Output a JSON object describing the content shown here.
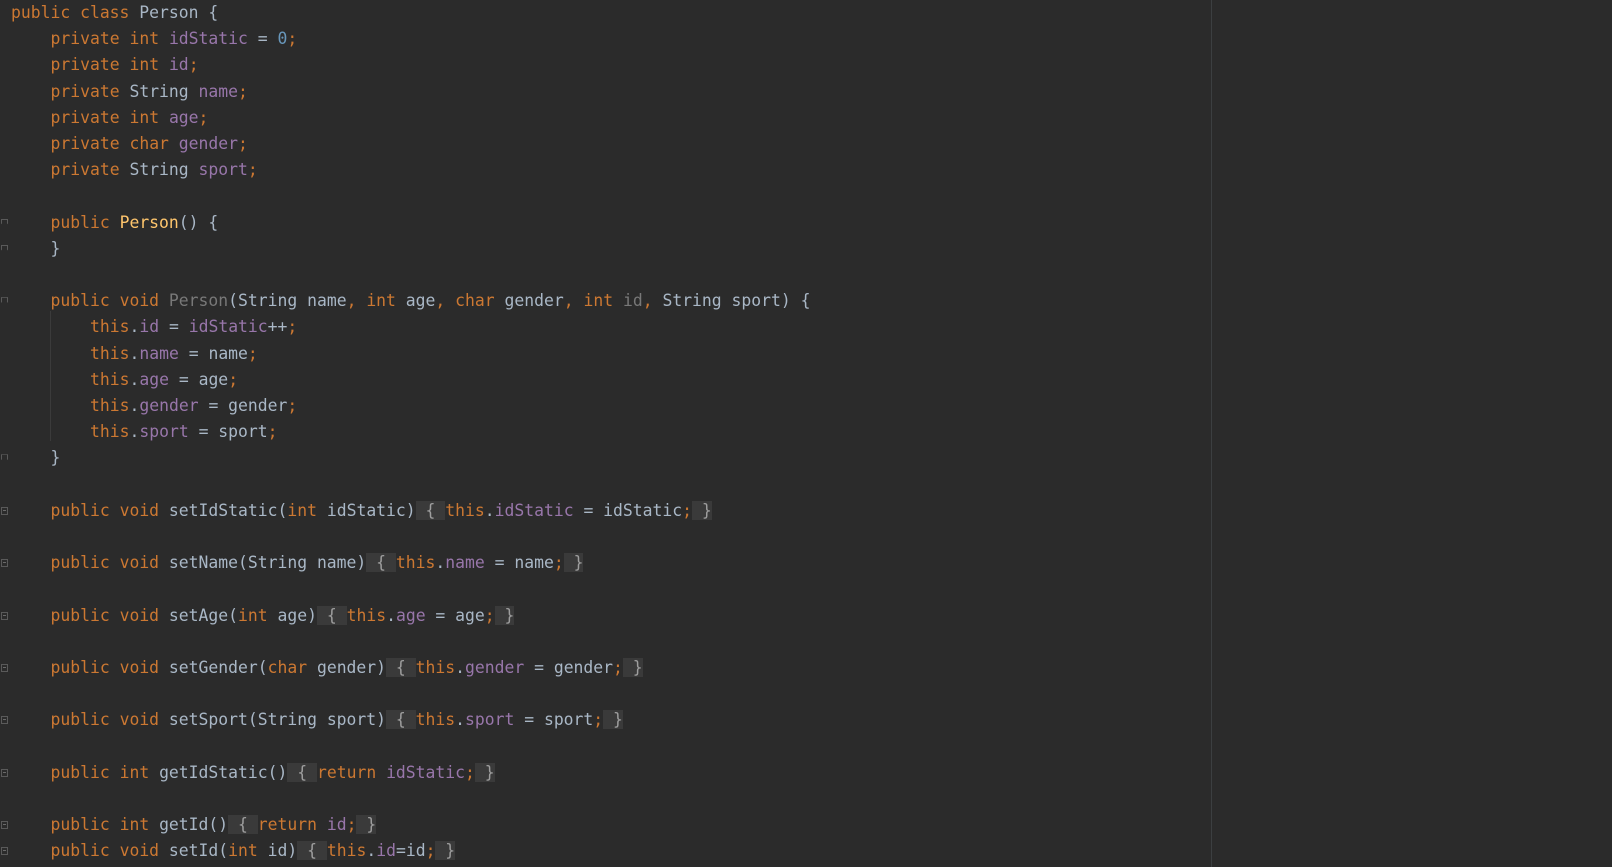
{
  "editor": {
    "lines": [
      {
        "indent": 0,
        "tokens": [
          [
            "kw",
            "public "
          ],
          [
            "kw",
            "class "
          ],
          [
            "",
            "Person {"
          ]
        ]
      },
      {
        "indent": 1,
        "tokens": [
          [
            "kw",
            "private "
          ],
          [
            "kw",
            "int "
          ],
          [
            "fld",
            "idStatic"
          ],
          [
            "",
            " = "
          ],
          [
            "num",
            "0"
          ],
          [
            "kw",
            ";"
          ]
        ]
      },
      {
        "indent": 1,
        "tokens": [
          [
            "kw",
            "private "
          ],
          [
            "kw",
            "int "
          ],
          [
            "fld",
            "id"
          ],
          [
            "kw",
            ";"
          ]
        ]
      },
      {
        "indent": 1,
        "tokens": [
          [
            "kw",
            "private "
          ],
          [
            "",
            "String "
          ],
          [
            "fld",
            "name"
          ],
          [
            "kw",
            ";"
          ]
        ]
      },
      {
        "indent": 1,
        "tokens": [
          [
            "kw",
            "private "
          ],
          [
            "kw",
            "int "
          ],
          [
            "fld",
            "age"
          ],
          [
            "kw",
            ";"
          ]
        ]
      },
      {
        "indent": 1,
        "tokens": [
          [
            "kw",
            "private "
          ],
          [
            "kw",
            "char "
          ],
          [
            "fld",
            "gender"
          ],
          [
            "kw",
            ";"
          ]
        ]
      },
      {
        "indent": 1,
        "tokens": [
          [
            "kw",
            "private "
          ],
          [
            "",
            "String "
          ],
          [
            "fld",
            "sport"
          ],
          [
            "kw",
            ";"
          ]
        ]
      },
      {
        "indent": 0,
        "tokens": []
      },
      {
        "indent": 1,
        "fold": "open",
        "tokens": [
          [
            "kw",
            "public "
          ],
          [
            "decl",
            "Person"
          ],
          [
            "",
            "() {"
          ]
        ]
      },
      {
        "indent": 1,
        "fold": "close",
        "tokens": [
          [
            "",
            "}"
          ]
        ]
      },
      {
        "indent": 0,
        "tokens": []
      },
      {
        "indent": 1,
        "fold": "open",
        "tokens": [
          [
            "kw",
            "public "
          ],
          [
            "kw",
            "void "
          ],
          [
            "gray",
            "Person"
          ],
          [
            "",
            "(String name"
          ],
          [
            "kw",
            ", "
          ],
          [
            "kw",
            "int "
          ],
          [
            "",
            "age"
          ],
          [
            "kw",
            ", "
          ],
          [
            "kw",
            "char "
          ],
          [
            "",
            "gender"
          ],
          [
            "kw",
            ", "
          ],
          [
            "kw",
            "int "
          ],
          [
            "gray",
            "id"
          ],
          [
            "kw",
            ", "
          ],
          [
            "",
            "String sport) {"
          ]
        ]
      },
      {
        "indent": 2,
        "tokens": [
          [
            "kw",
            "this"
          ],
          [
            "",
            "."
          ],
          [
            "fld",
            "id"
          ],
          [
            "",
            " = "
          ],
          [
            "fld",
            "idStatic"
          ],
          [
            "",
            "++"
          ],
          [
            "kw",
            ";"
          ]
        ]
      },
      {
        "indent": 2,
        "tokens": [
          [
            "kw",
            "this"
          ],
          [
            "",
            "."
          ],
          [
            "fld",
            "name"
          ],
          [
            "",
            " = name"
          ],
          [
            "kw",
            ";"
          ]
        ]
      },
      {
        "indent": 2,
        "tokens": [
          [
            "kw",
            "this"
          ],
          [
            "",
            "."
          ],
          [
            "fld",
            "age"
          ],
          [
            "",
            " = age"
          ],
          [
            "kw",
            ";"
          ]
        ]
      },
      {
        "indent": 2,
        "tokens": [
          [
            "kw",
            "this"
          ],
          [
            "",
            "."
          ],
          [
            "fld",
            "gender"
          ],
          [
            "",
            " = gender"
          ],
          [
            "kw",
            ";"
          ]
        ]
      },
      {
        "indent": 2,
        "tokens": [
          [
            "kw",
            "this"
          ],
          [
            "",
            "."
          ],
          [
            "fld",
            "sport"
          ],
          [
            "",
            " = sport"
          ],
          [
            "kw",
            ";"
          ]
        ]
      },
      {
        "indent": 1,
        "fold": "close",
        "tokens": [
          [
            "",
            "}"
          ]
        ]
      },
      {
        "indent": 0,
        "tokens": []
      },
      {
        "indent": 1,
        "fold": "collapsed",
        "tokens": [
          [
            "kw",
            "public "
          ],
          [
            "kw",
            "void "
          ],
          [
            "fn",
            "setIdStatic"
          ],
          [
            "",
            "("
          ],
          [
            "kw",
            "int "
          ],
          [
            "",
            "idStatic)"
          ],
          [
            "box",
            " { "
          ],
          [
            "kw",
            "this"
          ],
          [
            "",
            "."
          ],
          [
            "fld",
            "idStatic"
          ],
          [
            "",
            " = idStatic"
          ],
          [
            "boxsemi",
            "; }"
          ]
        ]
      },
      {
        "indent": 0,
        "tokens": []
      },
      {
        "indent": 1,
        "fold": "collapsed",
        "tokens": [
          [
            "kw",
            "public "
          ],
          [
            "kw",
            "void "
          ],
          [
            "fn",
            "setName"
          ],
          [
            "",
            "(String name)"
          ],
          [
            "box",
            " { "
          ],
          [
            "kw",
            "this"
          ],
          [
            "",
            "."
          ],
          [
            "fld",
            "name"
          ],
          [
            "",
            " = name"
          ],
          [
            "boxsemi",
            "; }"
          ]
        ]
      },
      {
        "indent": 0,
        "tokens": []
      },
      {
        "indent": 1,
        "fold": "collapsed",
        "tokens": [
          [
            "kw",
            "public "
          ],
          [
            "kw",
            "void "
          ],
          [
            "fn",
            "setAge"
          ],
          [
            "",
            "("
          ],
          [
            "kw",
            "int "
          ],
          [
            "",
            "age)"
          ],
          [
            "box",
            " { "
          ],
          [
            "kw",
            "this"
          ],
          [
            "",
            "."
          ],
          [
            "fld",
            "age"
          ],
          [
            "",
            " = age"
          ],
          [
            "boxsemi",
            "; }"
          ]
        ]
      },
      {
        "indent": 0,
        "tokens": []
      },
      {
        "indent": 1,
        "fold": "collapsed",
        "tokens": [
          [
            "kw",
            "public "
          ],
          [
            "kw",
            "void "
          ],
          [
            "fn",
            "setGender"
          ],
          [
            "",
            "("
          ],
          [
            "kw",
            "char "
          ],
          [
            "",
            "gender)"
          ],
          [
            "box",
            " { "
          ],
          [
            "kw",
            "this"
          ],
          [
            "",
            "."
          ],
          [
            "fld",
            "gender"
          ],
          [
            "",
            " = gender"
          ],
          [
            "boxsemi",
            "; }"
          ]
        ]
      },
      {
        "indent": 0,
        "tokens": []
      },
      {
        "indent": 1,
        "fold": "collapsed",
        "tokens": [
          [
            "kw",
            "public "
          ],
          [
            "kw",
            "void "
          ],
          [
            "fn",
            "setSport"
          ],
          [
            "",
            "(String sport)"
          ],
          [
            "box",
            " { "
          ],
          [
            "kw",
            "this"
          ],
          [
            "",
            "."
          ],
          [
            "fld",
            "sport"
          ],
          [
            "",
            " = sport"
          ],
          [
            "boxsemi",
            "; }"
          ]
        ]
      },
      {
        "indent": 0,
        "tokens": []
      },
      {
        "indent": 1,
        "fold": "collapsed",
        "tokens": [
          [
            "kw",
            "public "
          ],
          [
            "kw",
            "int "
          ],
          [
            "fn",
            "getIdStatic"
          ],
          [
            "",
            "()"
          ],
          [
            "box",
            " { "
          ],
          [
            "kw",
            "return "
          ],
          [
            "fld",
            "idStatic"
          ],
          [
            "boxsemi",
            "; }"
          ]
        ]
      },
      {
        "indent": 0,
        "tokens": []
      },
      {
        "indent": 1,
        "fold": "collapsed",
        "tokens": [
          [
            "kw",
            "public "
          ],
          [
            "kw",
            "int "
          ],
          [
            "fn",
            "getId"
          ],
          [
            "",
            "()"
          ],
          [
            "box",
            " { "
          ],
          [
            "kw",
            "return "
          ],
          [
            "fld",
            "id"
          ],
          [
            "boxsemi",
            "; }"
          ]
        ]
      },
      {
        "indent": 1,
        "fold": "collapsed",
        "tokens": [
          [
            "kw",
            "public "
          ],
          [
            "kw",
            "void "
          ],
          [
            "fn",
            "setId"
          ],
          [
            "",
            "("
          ],
          [
            "kw",
            "int "
          ],
          [
            "",
            "id)"
          ],
          [
            "box",
            " { "
          ],
          [
            "kw",
            "this"
          ],
          [
            "",
            "."
          ],
          [
            "fld",
            "id"
          ],
          [
            "",
            "=id"
          ],
          [
            "boxsemi",
            "; }"
          ]
        ]
      }
    ]
  },
  "colors": {
    "background": "#2b2b2b",
    "keyword": "#cc7832",
    "field": "#9876aa",
    "number": "#6897bb",
    "declaration": "#ffc66d",
    "default": "#a9b7c6"
  }
}
